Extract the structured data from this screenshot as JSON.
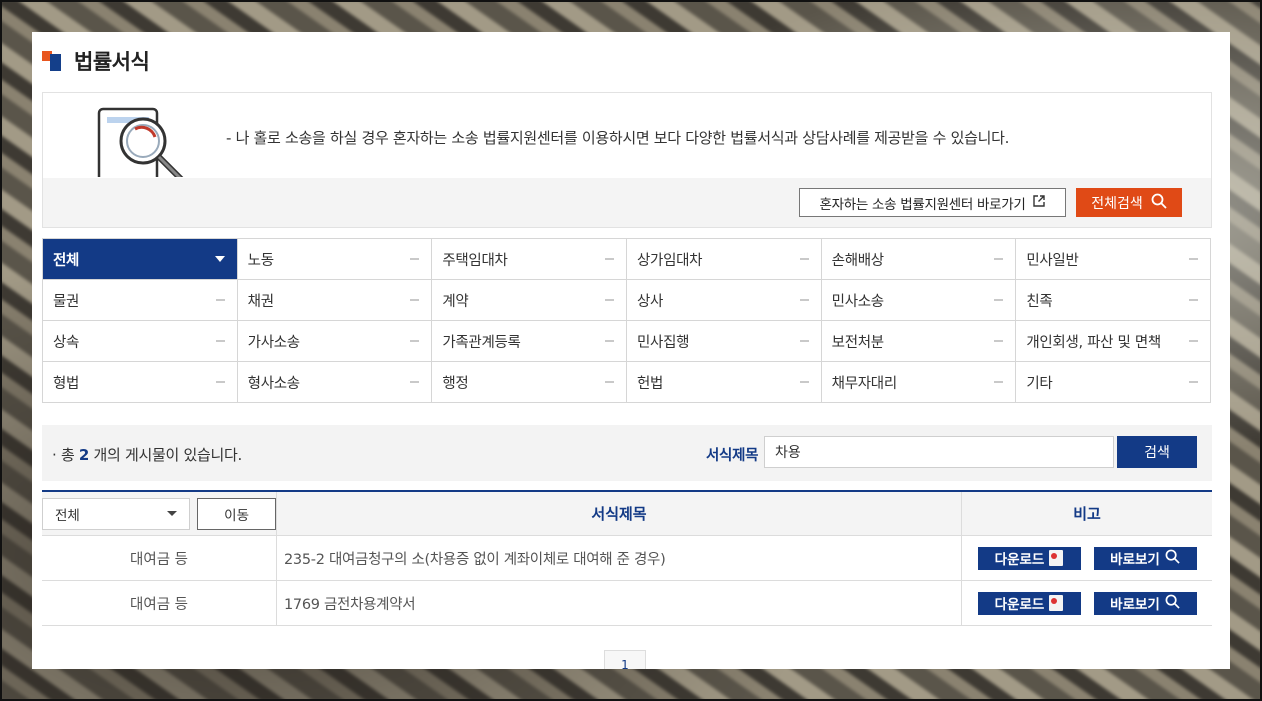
{
  "page": {
    "title": "법률서식"
  },
  "intro": {
    "text": "- 나 홀로 소송을 하실 경우 혼자하는 소송 법률지원센터를 이용하시면 보다 다양한 법률서식과 상담사례를 제공받을 수 있습니다.",
    "link_button": "혼자하는 소송 법률지원센터 바로가기",
    "search_all_button": "전체검색"
  },
  "categories": [
    {
      "label": "전체",
      "active": true
    },
    {
      "label": "노동"
    },
    {
      "label": "주택임대차"
    },
    {
      "label": "상가임대차"
    },
    {
      "label": "손해배상"
    },
    {
      "label": "민사일반"
    },
    {
      "label": "물권"
    },
    {
      "label": "채권"
    },
    {
      "label": "계약"
    },
    {
      "label": "상사"
    },
    {
      "label": "민사소송"
    },
    {
      "label": "친족"
    },
    {
      "label": "상속"
    },
    {
      "label": "가사소송"
    },
    {
      "label": "가족관계등록"
    },
    {
      "label": "민사집행"
    },
    {
      "label": "보전처분"
    },
    {
      "label": "개인회생, 파산 및 면책"
    },
    {
      "label": "형법"
    },
    {
      "label": "형사소송"
    },
    {
      "label": "행정"
    },
    {
      "label": "헌법"
    },
    {
      "label": "채무자대리"
    },
    {
      "label": "기타"
    }
  ],
  "search": {
    "count_prefix": "총",
    "count": "2",
    "count_suffix": "개의 게시물이 있습니다.",
    "label": "서식제목",
    "value": "차용",
    "button": "검색"
  },
  "table": {
    "filter_value": "전체",
    "move_button": "이동",
    "header_title": "서식제목",
    "header_note": "비고",
    "rows": [
      {
        "category": "대여금 등",
        "title": "235-2 대여금청구의 소(차용증 없이 계좌이체로 대여해 준 경우)",
        "download": "다운로드",
        "view": "바로보기"
      },
      {
        "category": "대여금 등",
        "title": "1769 금전차용계약서",
        "download": "다운로드",
        "view": "바로보기"
      }
    ]
  },
  "pagination": {
    "current": "1"
  },
  "colors": {
    "primary": "#133a86",
    "accent": "#e04a16"
  }
}
